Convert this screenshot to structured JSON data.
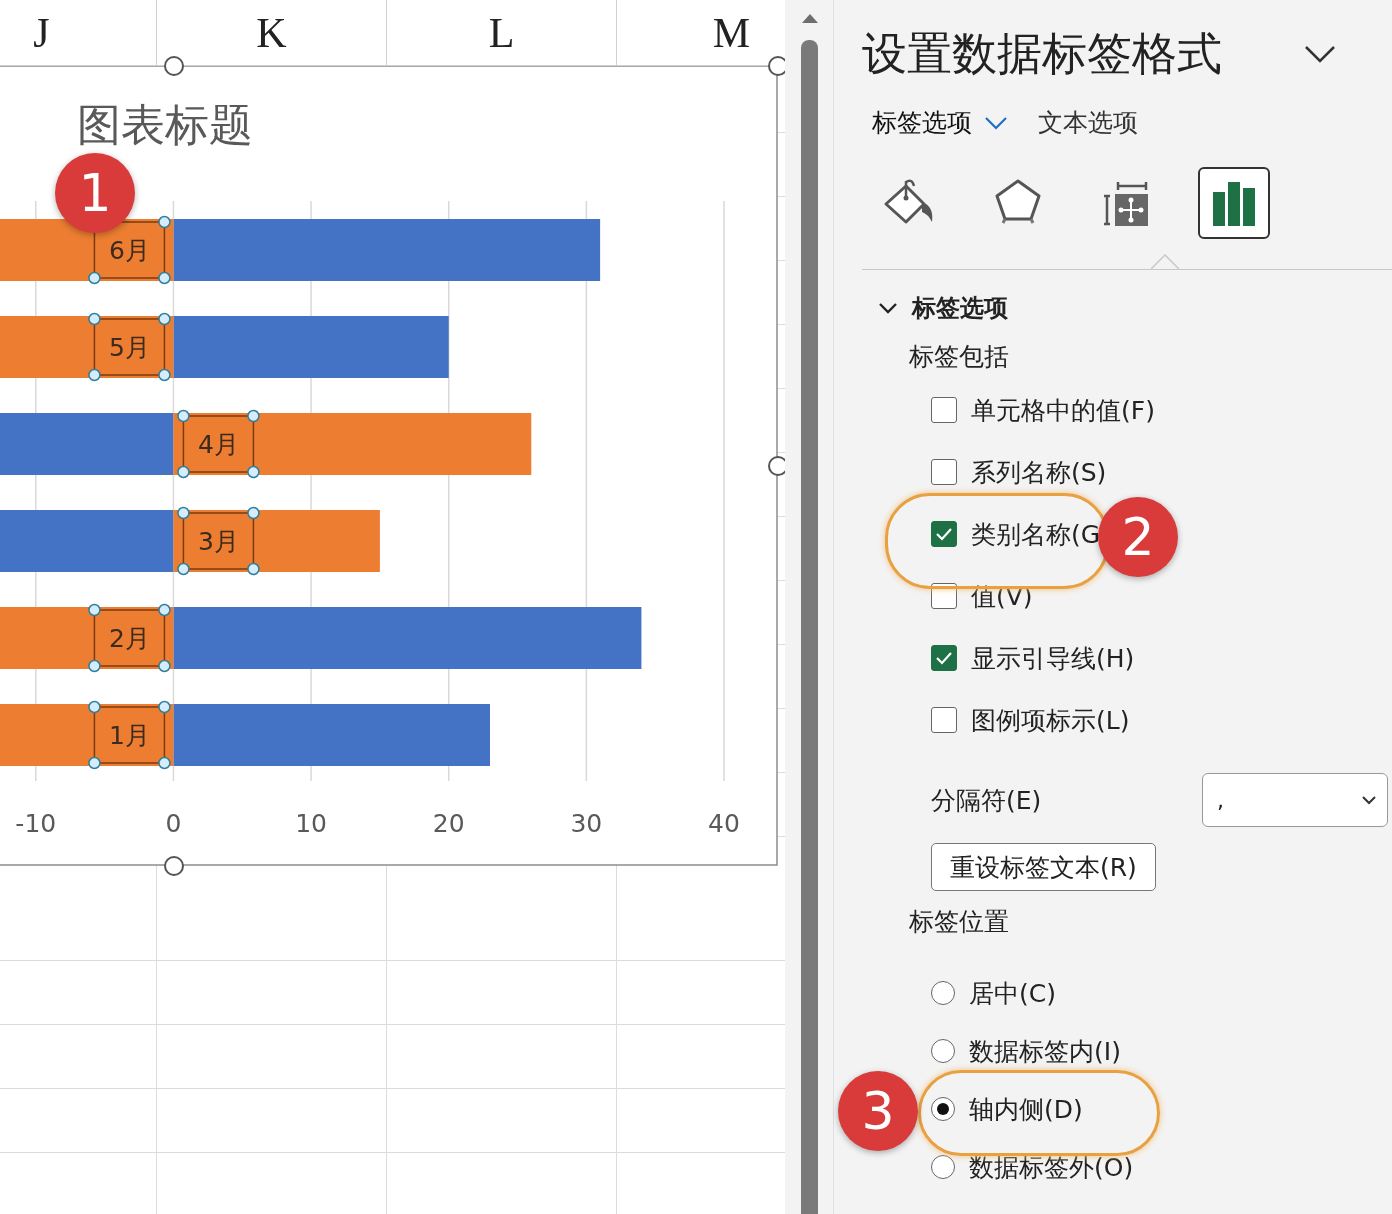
{
  "sheet": {
    "columns": [
      "J",
      "K",
      "L",
      "M"
    ]
  },
  "chart": {
    "title": "图表标题",
    "chart_data": {
      "type": "bar",
      "orientation": "horizontal",
      "stacked": true,
      "grid": true,
      "categories": [
        "6月",
        "5月",
        "4月",
        "3月",
        "2月",
        "1月"
      ],
      "series": [
        {
          "color": "#4472c4",
          "values": [
            31,
            20,
            -12.6,
            -12.6,
            34,
            23
          ]
        },
        {
          "color": "#ed7d31",
          "values": [
            -12.6,
            -12.6,
            26,
            15,
            -12.6,
            -12.6
          ]
        }
      ],
      "xlim": [
        -12.6,
        40
      ],
      "xticks": [
        -10,
        0,
        10,
        20,
        30,
        40
      ]
    }
  },
  "panel": {
    "title": "设置数据标签格式",
    "tabs": [
      {
        "label": "标签选项",
        "selected": true
      },
      {
        "label": "文本选项",
        "selected": false
      }
    ],
    "icon_tabs": [
      {
        "kind": "fill",
        "selected": false
      },
      {
        "kind": "effects",
        "selected": false
      },
      {
        "kind": "size",
        "selected": false
      },
      {
        "kind": "options",
        "selected": true
      }
    ],
    "section": {
      "title": "标签选项",
      "expanded": true
    },
    "label_contains": {
      "heading": "标签包括",
      "options": [
        {
          "label": "单元格中的值(F)",
          "checked": false
        },
        {
          "label": "系列名称(S)",
          "checked": false
        },
        {
          "label": "类别名称(G",
          "checked": true
        },
        {
          "label": "值(V)",
          "checked": false
        },
        {
          "label": "显示引导线(H)",
          "checked": true
        },
        {
          "label": "图例项标示(L)",
          "checked": false
        }
      ]
    },
    "separator": {
      "label": "分隔符(E)",
      "value": ","
    },
    "reset_button": "重设标签文本(R)",
    "label_position": {
      "heading": "标签位置",
      "options": [
        {
          "label": "居中(C)",
          "selected": false
        },
        {
          "label": "数据标签内(I)",
          "selected": false
        },
        {
          "label": "轴内侧(D)",
          "selected": true
        },
        {
          "label": "数据标签外(O)",
          "selected": false
        }
      ]
    }
  },
  "callouts": [
    {
      "number": "1"
    },
    {
      "number": "2"
    },
    {
      "number": "3"
    }
  ]
}
